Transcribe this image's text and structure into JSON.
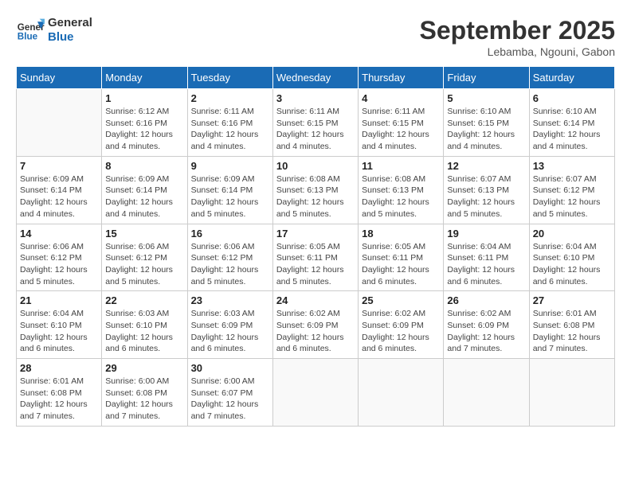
{
  "header": {
    "logo_general": "General",
    "logo_blue": "Blue",
    "month": "September 2025",
    "location": "Lebamba, Ngouni, Gabon"
  },
  "weekdays": [
    "Sunday",
    "Monday",
    "Tuesday",
    "Wednesday",
    "Thursday",
    "Friday",
    "Saturday"
  ],
  "weeks": [
    [
      {
        "day": "",
        "info": ""
      },
      {
        "day": "1",
        "info": "Sunrise: 6:12 AM\nSunset: 6:16 PM\nDaylight: 12 hours\nand 4 minutes."
      },
      {
        "day": "2",
        "info": "Sunrise: 6:11 AM\nSunset: 6:16 PM\nDaylight: 12 hours\nand 4 minutes."
      },
      {
        "day": "3",
        "info": "Sunrise: 6:11 AM\nSunset: 6:15 PM\nDaylight: 12 hours\nand 4 minutes."
      },
      {
        "day": "4",
        "info": "Sunrise: 6:11 AM\nSunset: 6:15 PM\nDaylight: 12 hours\nand 4 minutes."
      },
      {
        "day": "5",
        "info": "Sunrise: 6:10 AM\nSunset: 6:15 PM\nDaylight: 12 hours\nand 4 minutes."
      },
      {
        "day": "6",
        "info": "Sunrise: 6:10 AM\nSunset: 6:14 PM\nDaylight: 12 hours\nand 4 minutes."
      }
    ],
    [
      {
        "day": "7",
        "info": "Sunrise: 6:09 AM\nSunset: 6:14 PM\nDaylight: 12 hours\nand 4 minutes."
      },
      {
        "day": "8",
        "info": "Sunrise: 6:09 AM\nSunset: 6:14 PM\nDaylight: 12 hours\nand 4 minutes."
      },
      {
        "day": "9",
        "info": "Sunrise: 6:09 AM\nSunset: 6:14 PM\nDaylight: 12 hours\nand 5 minutes."
      },
      {
        "day": "10",
        "info": "Sunrise: 6:08 AM\nSunset: 6:13 PM\nDaylight: 12 hours\nand 5 minutes."
      },
      {
        "day": "11",
        "info": "Sunrise: 6:08 AM\nSunset: 6:13 PM\nDaylight: 12 hours\nand 5 minutes."
      },
      {
        "day": "12",
        "info": "Sunrise: 6:07 AM\nSunset: 6:13 PM\nDaylight: 12 hours\nand 5 minutes."
      },
      {
        "day": "13",
        "info": "Sunrise: 6:07 AM\nSunset: 6:12 PM\nDaylight: 12 hours\nand 5 minutes."
      }
    ],
    [
      {
        "day": "14",
        "info": "Sunrise: 6:06 AM\nSunset: 6:12 PM\nDaylight: 12 hours\nand 5 minutes."
      },
      {
        "day": "15",
        "info": "Sunrise: 6:06 AM\nSunset: 6:12 PM\nDaylight: 12 hours\nand 5 minutes."
      },
      {
        "day": "16",
        "info": "Sunrise: 6:06 AM\nSunset: 6:12 PM\nDaylight: 12 hours\nand 5 minutes."
      },
      {
        "day": "17",
        "info": "Sunrise: 6:05 AM\nSunset: 6:11 PM\nDaylight: 12 hours\nand 5 minutes."
      },
      {
        "day": "18",
        "info": "Sunrise: 6:05 AM\nSunset: 6:11 PM\nDaylight: 12 hours\nand 6 minutes."
      },
      {
        "day": "19",
        "info": "Sunrise: 6:04 AM\nSunset: 6:11 PM\nDaylight: 12 hours\nand 6 minutes."
      },
      {
        "day": "20",
        "info": "Sunrise: 6:04 AM\nSunset: 6:10 PM\nDaylight: 12 hours\nand 6 minutes."
      }
    ],
    [
      {
        "day": "21",
        "info": "Sunrise: 6:04 AM\nSunset: 6:10 PM\nDaylight: 12 hours\nand 6 minutes."
      },
      {
        "day": "22",
        "info": "Sunrise: 6:03 AM\nSunset: 6:10 PM\nDaylight: 12 hours\nand 6 minutes."
      },
      {
        "day": "23",
        "info": "Sunrise: 6:03 AM\nSunset: 6:09 PM\nDaylight: 12 hours\nand 6 minutes."
      },
      {
        "day": "24",
        "info": "Sunrise: 6:02 AM\nSunset: 6:09 PM\nDaylight: 12 hours\nand 6 minutes."
      },
      {
        "day": "25",
        "info": "Sunrise: 6:02 AM\nSunset: 6:09 PM\nDaylight: 12 hours\nand 6 minutes."
      },
      {
        "day": "26",
        "info": "Sunrise: 6:02 AM\nSunset: 6:09 PM\nDaylight: 12 hours\nand 7 minutes."
      },
      {
        "day": "27",
        "info": "Sunrise: 6:01 AM\nSunset: 6:08 PM\nDaylight: 12 hours\nand 7 minutes."
      }
    ],
    [
      {
        "day": "28",
        "info": "Sunrise: 6:01 AM\nSunset: 6:08 PM\nDaylight: 12 hours\nand 7 minutes."
      },
      {
        "day": "29",
        "info": "Sunrise: 6:00 AM\nSunset: 6:08 PM\nDaylight: 12 hours\nand 7 minutes."
      },
      {
        "day": "30",
        "info": "Sunrise: 6:00 AM\nSunset: 6:07 PM\nDaylight: 12 hours\nand 7 minutes."
      },
      {
        "day": "",
        "info": ""
      },
      {
        "day": "",
        "info": ""
      },
      {
        "day": "",
        "info": ""
      },
      {
        "day": "",
        "info": ""
      }
    ]
  ]
}
